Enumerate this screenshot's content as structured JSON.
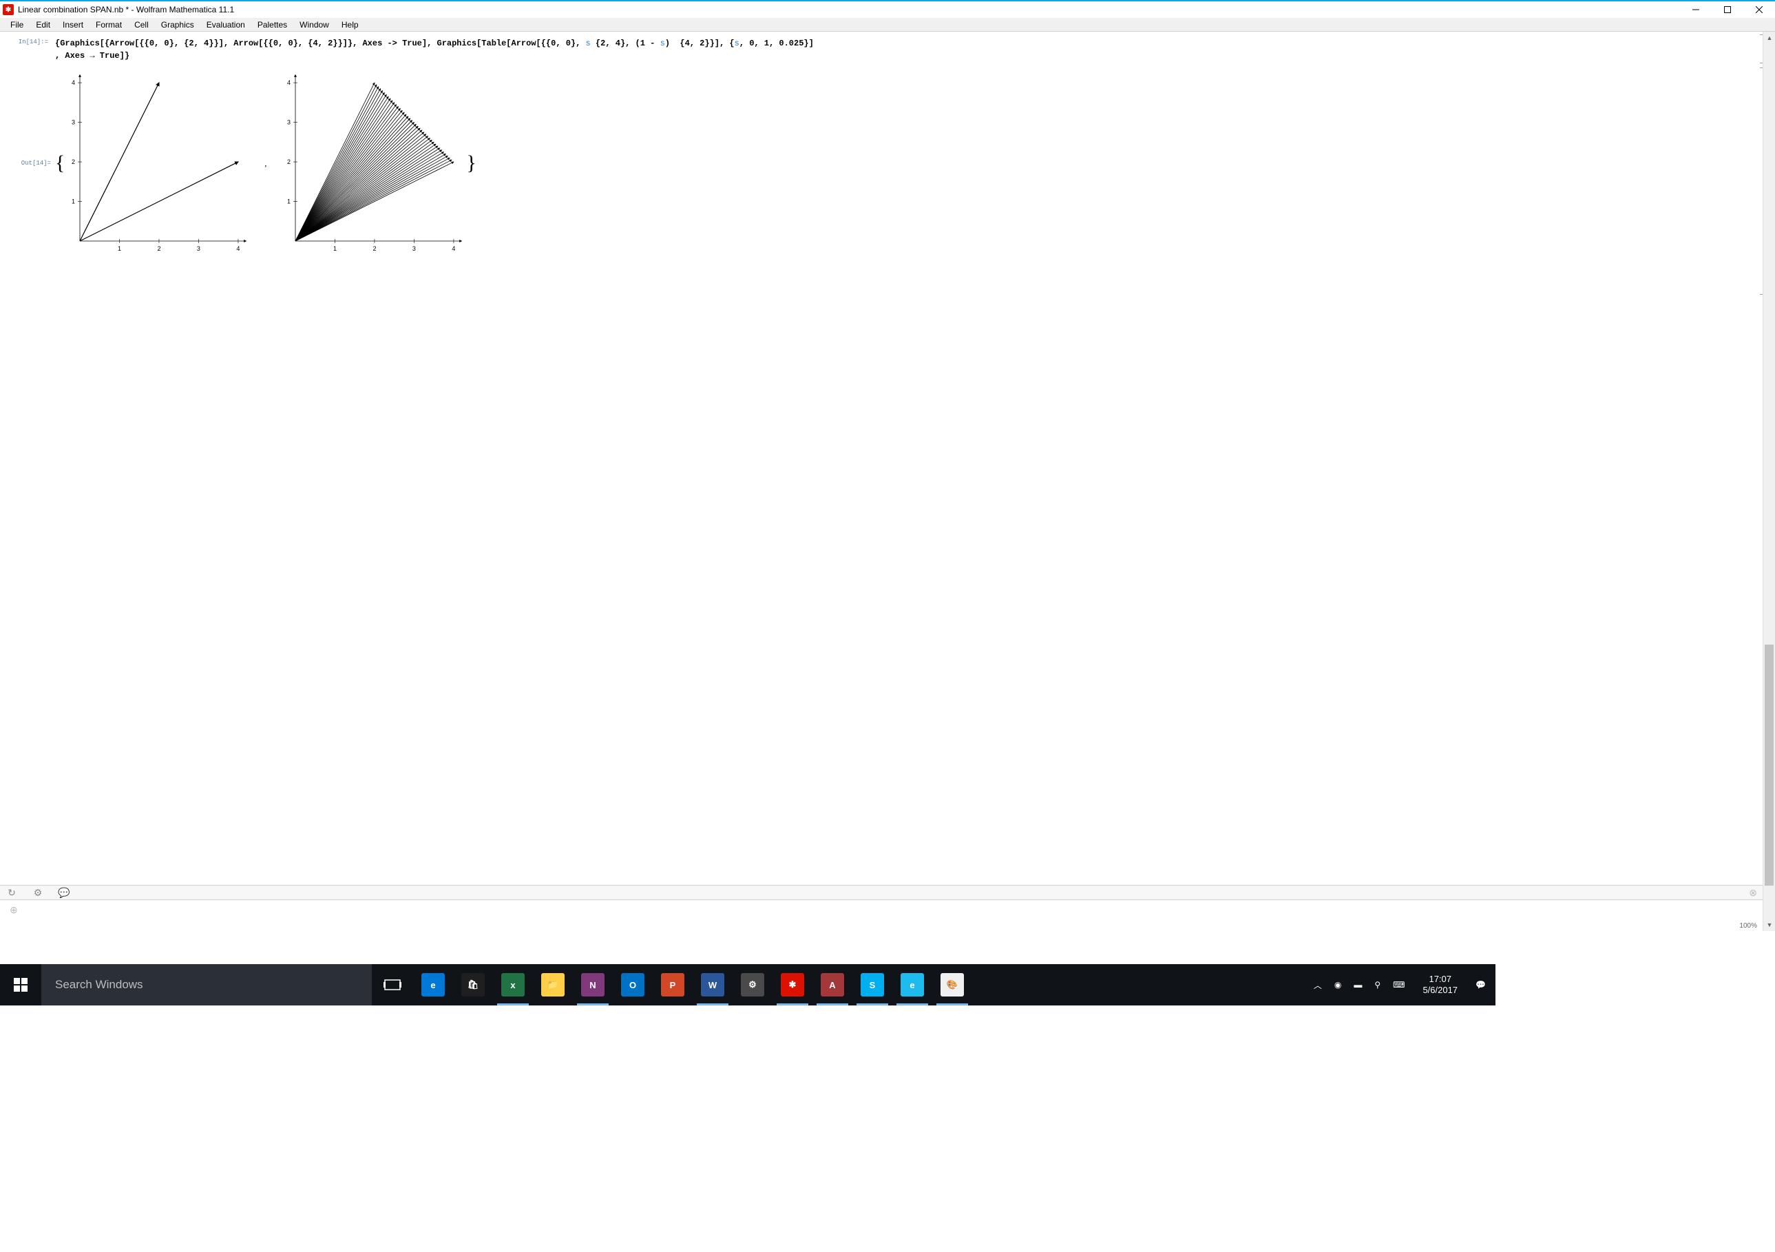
{
  "titlebar": {
    "app_icon_text": "✱",
    "title": "Linear combination SPAN.nb * - Wolfram Mathematica 11.1"
  },
  "menu": {
    "items": [
      "File",
      "Edit",
      "Insert",
      "Format",
      "Cell",
      "Graphics",
      "Evaluation",
      "Palettes",
      "Window",
      "Help"
    ]
  },
  "input": {
    "label": "In[14]:=",
    "code_line1_a": "{Graphics[{Arrow[{{0, 0}, {2, 4}}], Arrow[{{0, 0}, {4, 2}}]}, Axes -> True], Graphics[Table[Arrow[{{0, 0}, ",
    "code_line1_s1": "s",
    "code_line1_b": " {2, 4}, (1 - ",
    "code_line1_s2": "s",
    "code_line1_c": ")  {4, 2}}], {",
    "code_line1_s3": "s",
    "code_line1_d": ", 0, 1, 0.025}]",
    "code_line2": ", Axes → True]}"
  },
  "output": {
    "label": "Out[14]=",
    "brace_left": "{",
    "brace_right": "}",
    "comma": ","
  },
  "chart_data": [
    {
      "type": "line",
      "title": "",
      "xlabel": "",
      "ylabel": "",
      "xlim": [
        0,
        4.2
      ],
      "ylim": [
        0,
        4.2
      ],
      "xticks": [
        1,
        2,
        3,
        4
      ],
      "yticks": [
        1,
        2,
        3,
        4
      ],
      "series": [
        {
          "name": "arrow1",
          "x": [
            0,
            2
          ],
          "y": [
            0,
            4
          ],
          "marker": "arrow"
        },
        {
          "name": "arrow2",
          "x": [
            0,
            4
          ],
          "y": [
            0,
            2
          ],
          "marker": "arrow"
        }
      ]
    },
    {
      "type": "line",
      "title": "",
      "xlabel": "",
      "ylabel": "",
      "xlim": [
        0,
        4.2
      ],
      "ylim": [
        0,
        4.2
      ],
      "xticks": [
        1,
        2,
        3,
        4
      ],
      "yticks": [
        1,
        2,
        3,
        4
      ],
      "note": "Family of arrows from origin to s*{2,4}+(1-s)*{4,2} for s in 0..1 step 0.025",
      "series": [
        {
          "name": "s=0.000",
          "x": [
            0,
            4.0
          ],
          "y": [
            0,
            2.0
          ]
        },
        {
          "name": "s=0.025",
          "x": [
            0,
            3.95
          ],
          "y": [
            0,
            2.05
          ]
        },
        {
          "name": "s=0.050",
          "x": [
            0,
            3.9
          ],
          "y": [
            0,
            2.1
          ]
        },
        {
          "name": "s=0.075",
          "x": [
            0,
            3.85
          ],
          "y": [
            0,
            2.15
          ]
        },
        {
          "name": "s=0.100",
          "x": [
            0,
            3.8
          ],
          "y": [
            0,
            2.2
          ]
        },
        {
          "name": "s=0.125",
          "x": [
            0,
            3.75
          ],
          "y": [
            0,
            2.25
          ]
        },
        {
          "name": "s=0.150",
          "x": [
            0,
            3.7
          ],
          "y": [
            0,
            2.3
          ]
        },
        {
          "name": "s=0.175",
          "x": [
            0,
            3.65
          ],
          "y": [
            0,
            2.35
          ]
        },
        {
          "name": "s=0.200",
          "x": [
            0,
            3.6
          ],
          "y": [
            0,
            2.4
          ]
        },
        {
          "name": "s=0.225",
          "x": [
            0,
            3.55
          ],
          "y": [
            0,
            2.45
          ]
        },
        {
          "name": "s=0.250",
          "x": [
            0,
            3.5
          ],
          "y": [
            0,
            2.5
          ]
        },
        {
          "name": "s=0.275",
          "x": [
            0,
            3.45
          ],
          "y": [
            0,
            2.55
          ]
        },
        {
          "name": "s=0.300",
          "x": [
            0,
            3.4
          ],
          "y": [
            0,
            2.6
          ]
        },
        {
          "name": "s=0.325",
          "x": [
            0,
            3.35
          ],
          "y": [
            0,
            2.65
          ]
        },
        {
          "name": "s=0.350",
          "x": [
            0,
            3.3
          ],
          "y": [
            0,
            2.7
          ]
        },
        {
          "name": "s=0.375",
          "x": [
            0,
            3.25
          ],
          "y": [
            0,
            2.75
          ]
        },
        {
          "name": "s=0.400",
          "x": [
            0,
            3.2
          ],
          "y": [
            0,
            2.8
          ]
        },
        {
          "name": "s=0.425",
          "x": [
            0,
            3.15
          ],
          "y": [
            0,
            2.85
          ]
        },
        {
          "name": "s=0.450",
          "x": [
            0,
            3.1
          ],
          "y": [
            0,
            2.9
          ]
        },
        {
          "name": "s=0.475",
          "x": [
            0,
            3.05
          ],
          "y": [
            0,
            2.95
          ]
        },
        {
          "name": "s=0.500",
          "x": [
            0,
            3.0
          ],
          "y": [
            0,
            3.0
          ]
        },
        {
          "name": "s=0.525",
          "x": [
            0,
            2.95
          ],
          "y": [
            0,
            3.05
          ]
        },
        {
          "name": "s=0.550",
          "x": [
            0,
            2.9
          ],
          "y": [
            0,
            3.1
          ]
        },
        {
          "name": "s=0.575",
          "x": [
            0,
            2.85
          ],
          "y": [
            0,
            3.15
          ]
        },
        {
          "name": "s=0.600",
          "x": [
            0,
            2.8
          ],
          "y": [
            0,
            3.2
          ]
        },
        {
          "name": "s=0.625",
          "x": [
            0,
            2.75
          ],
          "y": [
            0,
            3.25
          ]
        },
        {
          "name": "s=0.650",
          "x": [
            0,
            2.7
          ],
          "y": [
            0,
            3.3
          ]
        },
        {
          "name": "s=0.675",
          "x": [
            0,
            2.65
          ],
          "y": [
            0,
            3.35
          ]
        },
        {
          "name": "s=0.700",
          "x": [
            0,
            2.6
          ],
          "y": [
            0,
            3.4
          ]
        },
        {
          "name": "s=0.725",
          "x": [
            0,
            2.55
          ],
          "y": [
            0,
            3.45
          ]
        },
        {
          "name": "s=0.750",
          "x": [
            0,
            2.5
          ],
          "y": [
            0,
            3.5
          ]
        },
        {
          "name": "s=0.775",
          "x": [
            0,
            2.45
          ],
          "y": [
            0,
            3.55
          ]
        },
        {
          "name": "s=0.800",
          "x": [
            0,
            2.4
          ],
          "y": [
            0,
            3.6
          ]
        },
        {
          "name": "s=0.825",
          "x": [
            0,
            2.35
          ],
          "y": [
            0,
            3.65
          ]
        },
        {
          "name": "s=0.850",
          "x": [
            0,
            2.3
          ],
          "y": [
            0,
            3.7
          ]
        },
        {
          "name": "s=0.875",
          "x": [
            0,
            2.25
          ],
          "y": [
            0,
            3.75
          ]
        },
        {
          "name": "s=0.900",
          "x": [
            0,
            2.2
          ],
          "y": [
            0,
            3.8
          ]
        },
        {
          "name": "s=0.925",
          "x": [
            0,
            2.15
          ],
          "y": [
            0,
            3.85
          ]
        },
        {
          "name": "s=0.950",
          "x": [
            0,
            2.1
          ],
          "y": [
            0,
            3.9
          ]
        },
        {
          "name": "s=0.975",
          "x": [
            0,
            2.05
          ],
          "y": [
            0,
            3.95
          ]
        },
        {
          "name": "s=1.000",
          "x": [
            0,
            2.0
          ],
          "y": [
            0,
            4.0
          ]
        }
      ]
    }
  ],
  "footer": {
    "zoom": "100%"
  },
  "taskbar": {
    "search_placeholder": "Search Windows",
    "time": "17:07",
    "date": "5/6/2017",
    "apps": [
      {
        "name": "edge",
        "bg": "#0078d7",
        "txt": "e"
      },
      {
        "name": "store",
        "bg": "#1f1f1f",
        "txt": "🛍"
      },
      {
        "name": "excel",
        "bg": "#217346",
        "txt": "x"
      },
      {
        "name": "file-explorer",
        "bg": "#ffcf48",
        "txt": "📁"
      },
      {
        "name": "onenote",
        "bg": "#80397b",
        "txt": "N"
      },
      {
        "name": "outlook",
        "bg": "#0072c6",
        "txt": "O"
      },
      {
        "name": "powerpoint",
        "bg": "#d24726",
        "txt": "P"
      },
      {
        "name": "word",
        "bg": "#2b579a",
        "txt": "W"
      },
      {
        "name": "settings-gear",
        "bg": "#4a4a4a",
        "txt": "⚙"
      },
      {
        "name": "mathematica",
        "bg": "#dd1100",
        "txt": "✱"
      },
      {
        "name": "access",
        "bg": "#a4373a",
        "txt": "A"
      },
      {
        "name": "skype",
        "bg": "#00aff0",
        "txt": "S"
      },
      {
        "name": "ie",
        "bg": "#1ebbee",
        "txt": "e"
      },
      {
        "name": "paint",
        "bg": "#f0f0f0",
        "txt": "🎨"
      }
    ]
  }
}
